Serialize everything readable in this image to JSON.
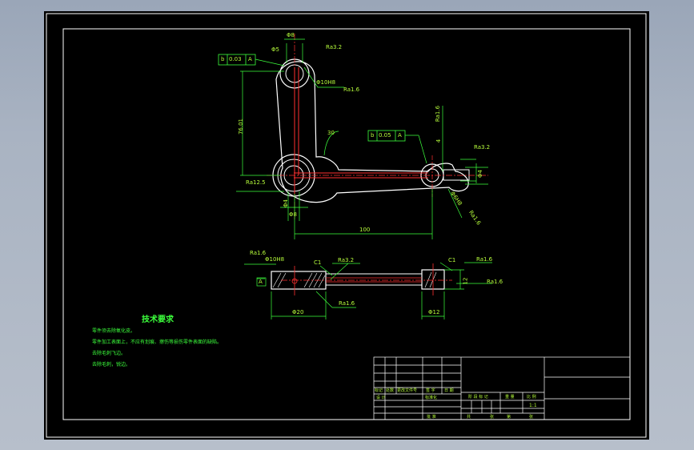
{
  "dimensions": {
    "top_width": "Φ8",
    "angle_note": "Φ5",
    "top_tol": "Φ10H8",
    "length": "76.01",
    "angle": "30",
    "ra_bottom_left": "Ra12.5",
    "dim_s": "Φ4",
    "dim_b": "Φ8",
    "horizontal": "100",
    "right_tol": "Φ6H8",
    "right_h": "4",
    "dim_r": "Φ4",
    "ra_top1": "Ra3.2",
    "ra_top2": "Ra1.6",
    "ra_right1": "Ra1.6",
    "ra_right2": "Ra3.2",
    "ra_right3": "Ra1.6"
  },
  "tolerance_frames": [
    {
      "symbol": "b",
      "value": "0.03",
      "datum": "A"
    },
    {
      "symbol": "b",
      "value": "0.05",
      "datum": "A"
    }
  ],
  "section": {
    "tol1": "Φ10H8",
    "c1": "C1",
    "ra1": "Ra3.2",
    "c2": "C1",
    "ra2": "Ra1.6",
    "ra3": "Ra1.6",
    "ra_left": "Ra1.6",
    "datum": "A",
    "ra_bottom": "Ra1.6",
    "dim_left": "Φ20",
    "dim_right": "Φ12",
    "dim_h": "12"
  },
  "tech": {
    "title": "技术要求",
    "lines": [
      "零件须去除氧化皮。",
      "零件加工表面上，不应有划痕、擦伤等损伤零件表面的缺陷。",
      "去除毛刺飞边。",
      "去除毛刺，锐边。"
    ]
  },
  "title_block": {
    "headers": [
      "标记",
      "处数",
      "更改文件号",
      "签 字",
      "日 期"
    ],
    "row2": [
      "设 计",
      "标准化"
    ],
    "stage_headers": [
      "阶 段 标 记",
      "重 量",
      "比 例"
    ],
    "scale": "1:1",
    "approve": "批 准",
    "sheet": [
      "共",
      "张",
      "第",
      "张"
    ]
  }
}
